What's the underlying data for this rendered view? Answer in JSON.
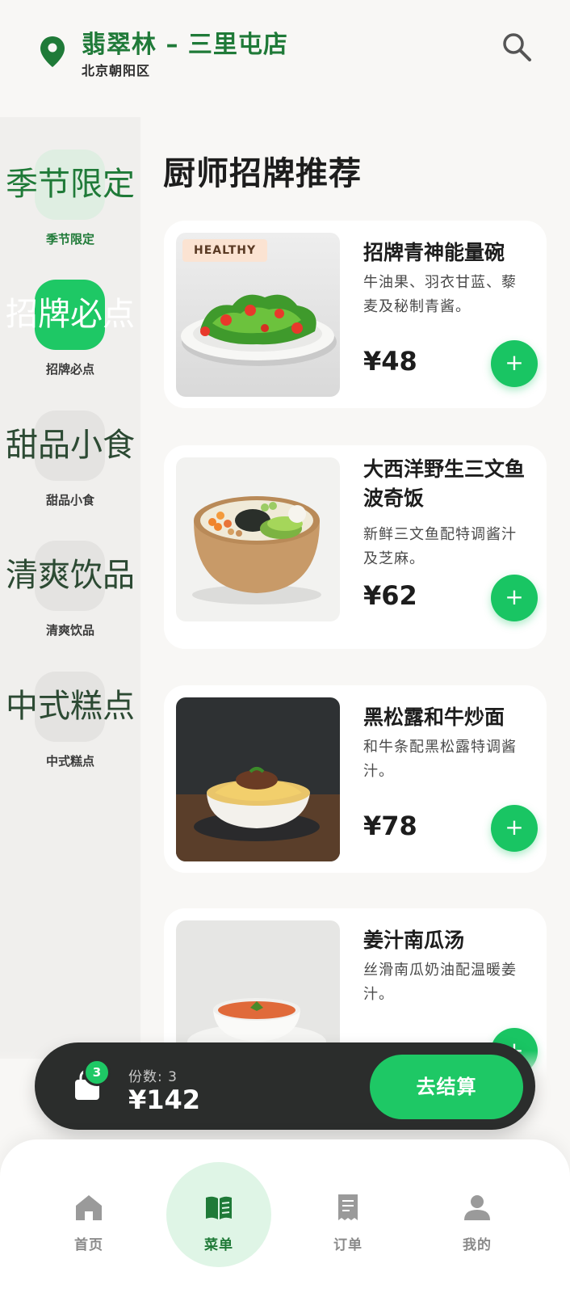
{
  "header": {
    "store_name": "翡翠林 – 三里屯店",
    "store_area": "北京朝阳区"
  },
  "sidebar": {
    "categories": [
      {
        "big": "季节限定",
        "label": "季节限定"
      },
      {
        "big": "招牌必点",
        "label": "招牌必点",
        "active": true
      },
      {
        "big": "甜品小食",
        "label": "甜品小食"
      },
      {
        "big": "清爽饮品",
        "label": "清爽饮品"
      },
      {
        "big": "中式糕点",
        "label": "中式糕点"
      }
    ]
  },
  "section_title": "厨师招牌推荐",
  "items": [
    {
      "badge": "HEALTHY",
      "title": "招牌青神能量碗",
      "desc": "牛油果、羽衣甘蓝、藜麦及秘制青酱。",
      "price": "¥48",
      "add": "+"
    },
    {
      "title": "大西洋野生三文鱼波奇饭",
      "desc": "新鲜三文鱼配特调酱汁及芝麻。",
      "price": "¥62",
      "add": "+"
    },
    {
      "title": "黑松露和牛炒面",
      "desc": "和牛条配黑松露特调酱汁。",
      "price": "¥78",
      "add": "+"
    },
    {
      "title": "姜汁南瓜汤",
      "desc": "丝滑南瓜奶油配温暖姜汁。",
      "add": "+"
    }
  ],
  "cart": {
    "count": "3",
    "qty_label": "份数: 3",
    "total": "¥142",
    "checkout": "去结算"
  },
  "nav": {
    "items": [
      {
        "label": "首页",
        "icon": "home-icon"
      },
      {
        "label": "菜单",
        "icon": "menu-book-icon",
        "active": true
      },
      {
        "label": "订单",
        "icon": "receipt-icon"
      },
      {
        "label": "我的",
        "icon": "person-icon"
      }
    ]
  },
  "colors": {
    "brand_green": "#1f7a38",
    "accent_green": "#1ec865",
    "cart_bar": "#2b2d2c"
  }
}
